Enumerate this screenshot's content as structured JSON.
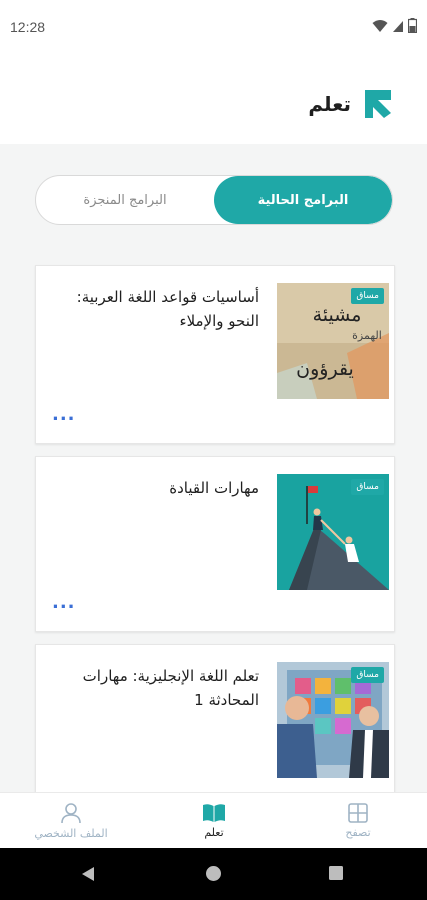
{
  "status_bar": {
    "time": "12:28"
  },
  "header": {
    "title": "تعلم",
    "logo_icon": "brand-arrow-logo"
  },
  "tabs": {
    "active": "البرامج الحالية",
    "inactive": "البرامج المنجزة"
  },
  "programs": [
    {
      "title": "أساسيات قواعد اللغة العربية: النحو والإملاء",
      "badge": "مساق",
      "menu": "...",
      "thumb_words": {
        "w1": "مشيئة",
        "w2": "الهمزة",
        "w3": "يقرؤون"
      }
    },
    {
      "title": "مهارات القيادة",
      "badge": "مساق",
      "menu": "..."
    },
    {
      "title": "تعلم اللغة الإنجليزية: مهارات المحادثة 1",
      "badge": "مساق",
      "menu": "..."
    }
  ],
  "bottom_nav": {
    "profile": "الملف الشخصي",
    "learn": "تعلم",
    "browse": "تصفح"
  },
  "colors": {
    "accent": "#1fa8a7",
    "menu_dots": "#3b6fd6",
    "nav_inactive": "#9fb3c4"
  }
}
